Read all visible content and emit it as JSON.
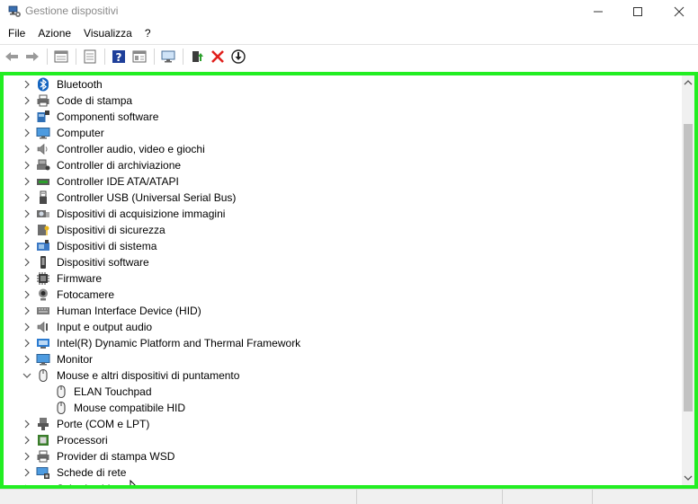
{
  "window": {
    "title": "Gestione dispositivi",
    "icon": "device-manager-icon"
  },
  "menu": [
    "File",
    "Azione",
    "Visualizza",
    "?"
  ],
  "toolbar": {
    "buttons": [
      "back-arrow-icon",
      "forward-arrow-icon",
      "properties-window-icon",
      "document-icon",
      "help-icon",
      "details-view-icon",
      "monitor-icon",
      "update-driver-icon",
      "uninstall-x-icon",
      "download-circle-icon"
    ],
    "colors": {
      "uninstall": "#e0201c",
      "help": "#1e3f9a"
    }
  },
  "tree": {
    "items": [
      {
        "label": "Bluetooth",
        "icon": "bluetooth-icon",
        "expanded": false,
        "level": 0
      },
      {
        "label": "Code di stampa",
        "icon": "printer-icon",
        "expanded": false,
        "level": 0
      },
      {
        "label": "Componenti software",
        "icon": "software-component-icon",
        "expanded": false,
        "level": 0
      },
      {
        "label": "Computer",
        "icon": "computer-icon",
        "expanded": false,
        "level": 0
      },
      {
        "label": "Controller audio, video e giochi",
        "icon": "speaker-icon",
        "expanded": false,
        "level": 0
      },
      {
        "label": "Controller di archiviazione",
        "icon": "storage-controller-icon",
        "expanded": false,
        "level": 0
      },
      {
        "label": "Controller IDE ATA/ATAPI",
        "icon": "ide-controller-icon",
        "expanded": false,
        "level": 0
      },
      {
        "label": "Controller USB (Universal Serial Bus)",
        "icon": "usb-icon",
        "expanded": false,
        "level": 0
      },
      {
        "label": "Dispositivi di acquisizione immagini",
        "icon": "camera-scanner-icon",
        "expanded": false,
        "level": 0
      },
      {
        "label": "Dispositivi di sicurezza",
        "icon": "security-key-icon",
        "expanded": false,
        "level": 0
      },
      {
        "label": "Dispositivi di sistema",
        "icon": "system-device-icon",
        "expanded": false,
        "level": 0
      },
      {
        "label": "Dispositivi software",
        "icon": "software-device-icon",
        "expanded": false,
        "level": 0
      },
      {
        "label": "Firmware",
        "icon": "firmware-chip-icon",
        "expanded": false,
        "level": 0
      },
      {
        "label": "Fotocamere",
        "icon": "webcam-icon",
        "expanded": false,
        "level": 0
      },
      {
        "label": "Human Interface Device (HID)",
        "icon": "hid-keyboard-icon",
        "expanded": false,
        "level": 0
      },
      {
        "label": "Input e output audio",
        "icon": "audio-io-icon",
        "expanded": false,
        "level": 0
      },
      {
        "label": "Intel(R) Dynamic Platform and Thermal Framework",
        "icon": "intel-framework-icon",
        "expanded": false,
        "level": 0
      },
      {
        "label": "Monitor",
        "icon": "monitor-icon",
        "expanded": false,
        "level": 0
      },
      {
        "label": "Mouse e altri dispositivi di puntamento",
        "icon": "mouse-icon",
        "expanded": true,
        "level": 0
      },
      {
        "label": "ELAN Touchpad",
        "icon": "mouse-icon",
        "expanded": null,
        "level": 1
      },
      {
        "label": "Mouse compatibile HID",
        "icon": "mouse-icon",
        "expanded": null,
        "level": 1
      },
      {
        "label": "Porte (COM e LPT)",
        "icon": "port-icon",
        "expanded": false,
        "level": 0
      },
      {
        "label": "Processori",
        "icon": "processor-icon",
        "expanded": false,
        "level": 0
      },
      {
        "label": "Provider di stampa WSD",
        "icon": "printer-icon",
        "expanded": false,
        "level": 0
      },
      {
        "label": "Schede di rete",
        "icon": "network-adapter-icon",
        "expanded": false,
        "level": 0
      },
      {
        "label": "Schede video",
        "icon": "display-adapter-icon",
        "expanded": false,
        "level": 0
      }
    ]
  },
  "colors": {
    "highlight_frame": "#22ee22",
    "scroll_thumb": "#c2c2c2",
    "title_text": "#8a8a8a"
  }
}
